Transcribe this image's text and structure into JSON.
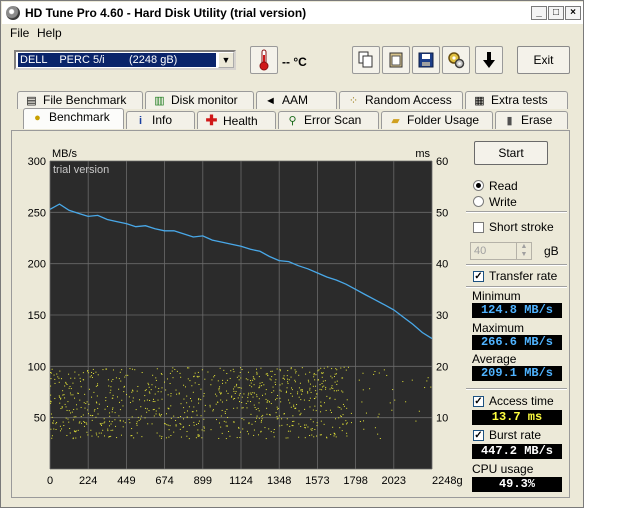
{
  "window": {
    "title": "HD Tune Pro 4.60 - Hard Disk Utility (trial version)",
    "minimize": "_",
    "maximize": "□",
    "close": "×"
  },
  "menu": {
    "file": "File",
    "help": "Help"
  },
  "toolbar": {
    "drive": "DELL    PERC 5/i        (2248 gB)",
    "temperature": "-- °C",
    "exit": "Exit"
  },
  "tabs_row1": [
    {
      "label": "File Benchmark",
      "icon": "document-icon"
    },
    {
      "label": "Disk monitor",
      "icon": "chart-icon"
    },
    {
      "label": "AAM",
      "icon": "speaker-icon"
    },
    {
      "label": "Random Access",
      "icon": "scatter-icon"
    },
    {
      "label": "Extra tests",
      "icon": "grid-icon"
    }
  ],
  "tabs_row2": [
    {
      "label": "Benchmark",
      "icon": "bulb-icon"
    },
    {
      "label": "Info",
      "icon": "info-icon"
    },
    {
      "label": "Health",
      "icon": "cross-icon"
    },
    {
      "label": "Error Scan",
      "icon": "magnifier-icon"
    },
    {
      "label": "Folder Usage",
      "icon": "folder-icon"
    },
    {
      "label": "Erase",
      "icon": "trash-icon"
    }
  ],
  "controls": {
    "start": "Start",
    "read": "Read",
    "write": "Write",
    "short_stroke": "Short stroke",
    "short_stroke_value": "40",
    "short_stroke_unit": "gB",
    "transfer_rate": "Transfer rate",
    "minimum_label": "Minimum",
    "minimum_value": "124.8 MB/s",
    "maximum_label": "Maximum",
    "maximum_value": "266.6 MB/s",
    "average_label": "Average",
    "average_value": "209.1 MB/s",
    "access_time": "Access time",
    "access_time_value": "13.7 ms",
    "burst_rate": "Burst rate",
    "burst_rate_value": "447.2 MB/s",
    "cpu_usage": "CPU usage",
    "cpu_usage_value": "49.3%"
  },
  "colors": {
    "transfer_line": "#49a8e8",
    "access_dots": "#e8e838",
    "plot_bg": "#2b2b2b",
    "grid": "#6a6a6a"
  },
  "chart_data": {
    "type": "line",
    "watermark": "trial version",
    "left_unit": "MB/s",
    "right_unit": "ms",
    "xlabel": "gB",
    "x_ticks": [
      "0",
      "224",
      "449",
      "674",
      "899",
      "1124",
      "1348",
      "1573",
      "1798",
      "2023",
      "2248gB"
    ],
    "y_left_ticks": [
      "300",
      "250",
      "200",
      "150",
      "100",
      "50"
    ],
    "y_right_ticks": [
      "60",
      "50",
      "40",
      "30",
      "20",
      "10"
    ],
    "xlim": [
      0,
      2248
    ],
    "ylim_left": [
      0,
      300
    ],
    "ylim_right": [
      0,
      60
    ],
    "grid": true,
    "series": [
      {
        "name": "Transfer rate",
        "axis": "left",
        "x": [
          0,
          56,
          112,
          168,
          224,
          281,
          337,
          393,
          449,
          505,
          562,
          618,
          674,
          730,
          787,
          843,
          899,
          955,
          1011,
          1068,
          1124,
          1180,
          1236,
          1292,
          1348,
          1405,
          1461,
          1517,
          1573,
          1629,
          1686,
          1742,
          1798,
          1854,
          1910,
          1967,
          2023,
          2079,
          2135,
          2191,
          2248
        ],
        "y": [
          253,
          258,
          252,
          249,
          246,
          247,
          243,
          241,
          239,
          236,
          237,
          234,
          232,
          232,
          229,
          226,
          227,
          223,
          221,
          219,
          217,
          214,
          212,
          207,
          203,
          202,
          198,
          195,
          191,
          187,
          184,
          180,
          175,
          170,
          165,
          160,
          155,
          148,
          141,
          133,
          127
        ]
      },
      {
        "name": "Access time",
        "axis": "right",
        "type": "scatter",
        "y_range": [
          6,
          20
        ],
        "mean": 13.7
      }
    ]
  }
}
